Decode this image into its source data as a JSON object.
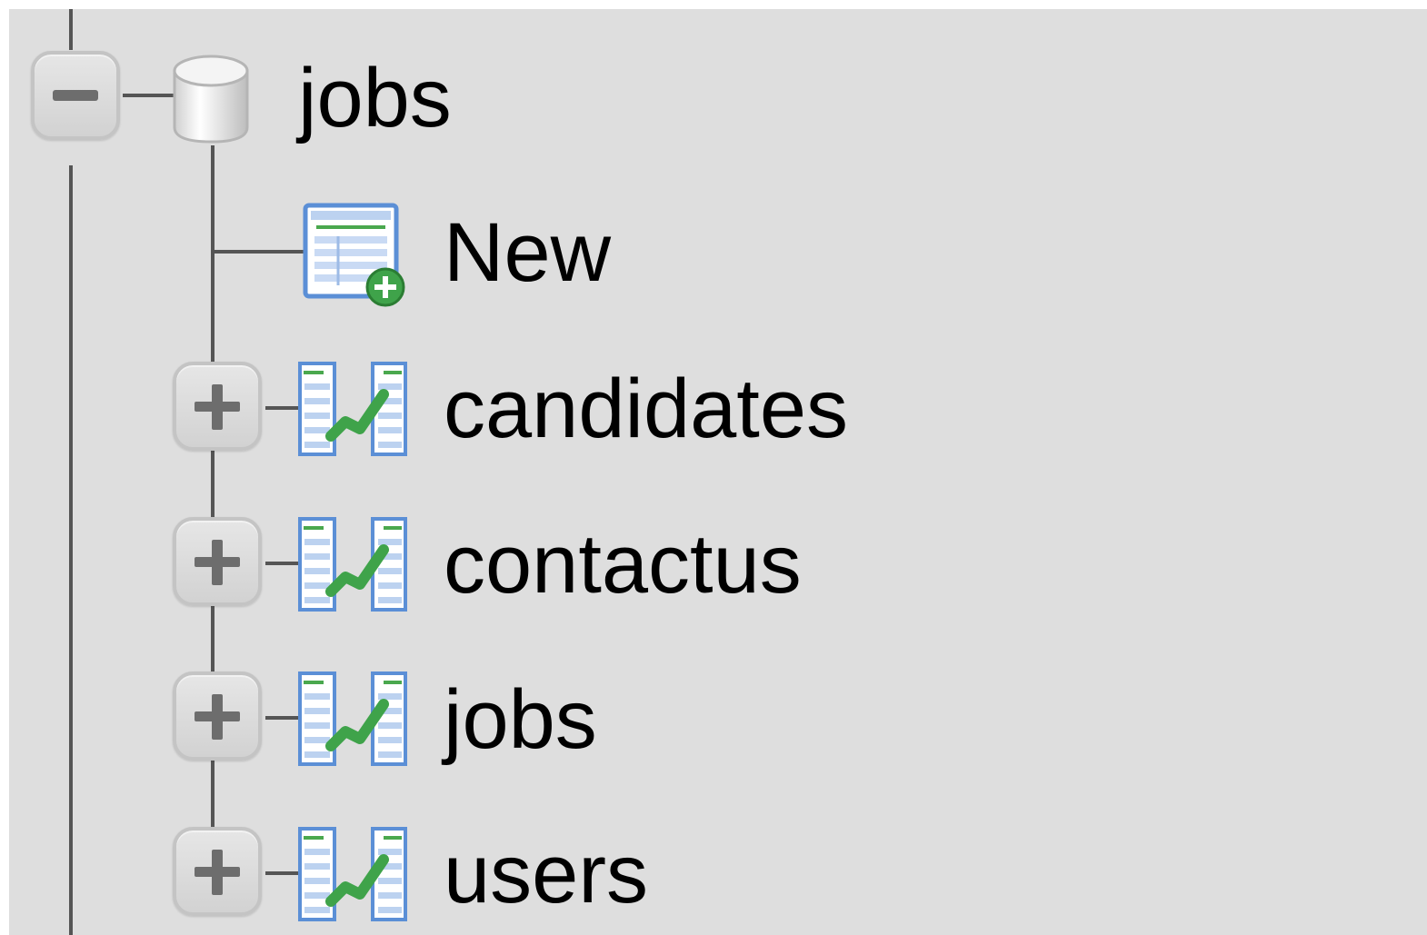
{
  "tree": {
    "database": {
      "label": "jobs",
      "toggle_icon": "minus-icon",
      "icon": "database-cylinder-icon"
    },
    "new_item": {
      "label": "New",
      "icon": "new-table-icon"
    },
    "tables": [
      {
        "label": "candidates",
        "toggle_icon": "plus-icon",
        "icon": "table-icon"
      },
      {
        "label": "contactus",
        "toggle_icon": "plus-icon",
        "icon": "table-icon"
      },
      {
        "label": "jobs",
        "toggle_icon": "plus-icon",
        "icon": "table-icon"
      },
      {
        "label": "users",
        "toggle_icon": "plus-icon",
        "icon": "table-icon"
      }
    ]
  },
  "colors": {
    "panel_bg": "#dedede",
    "tree_line": "#555555",
    "icon_blue": "#5b8fd6",
    "icon_green": "#3fa34a"
  }
}
